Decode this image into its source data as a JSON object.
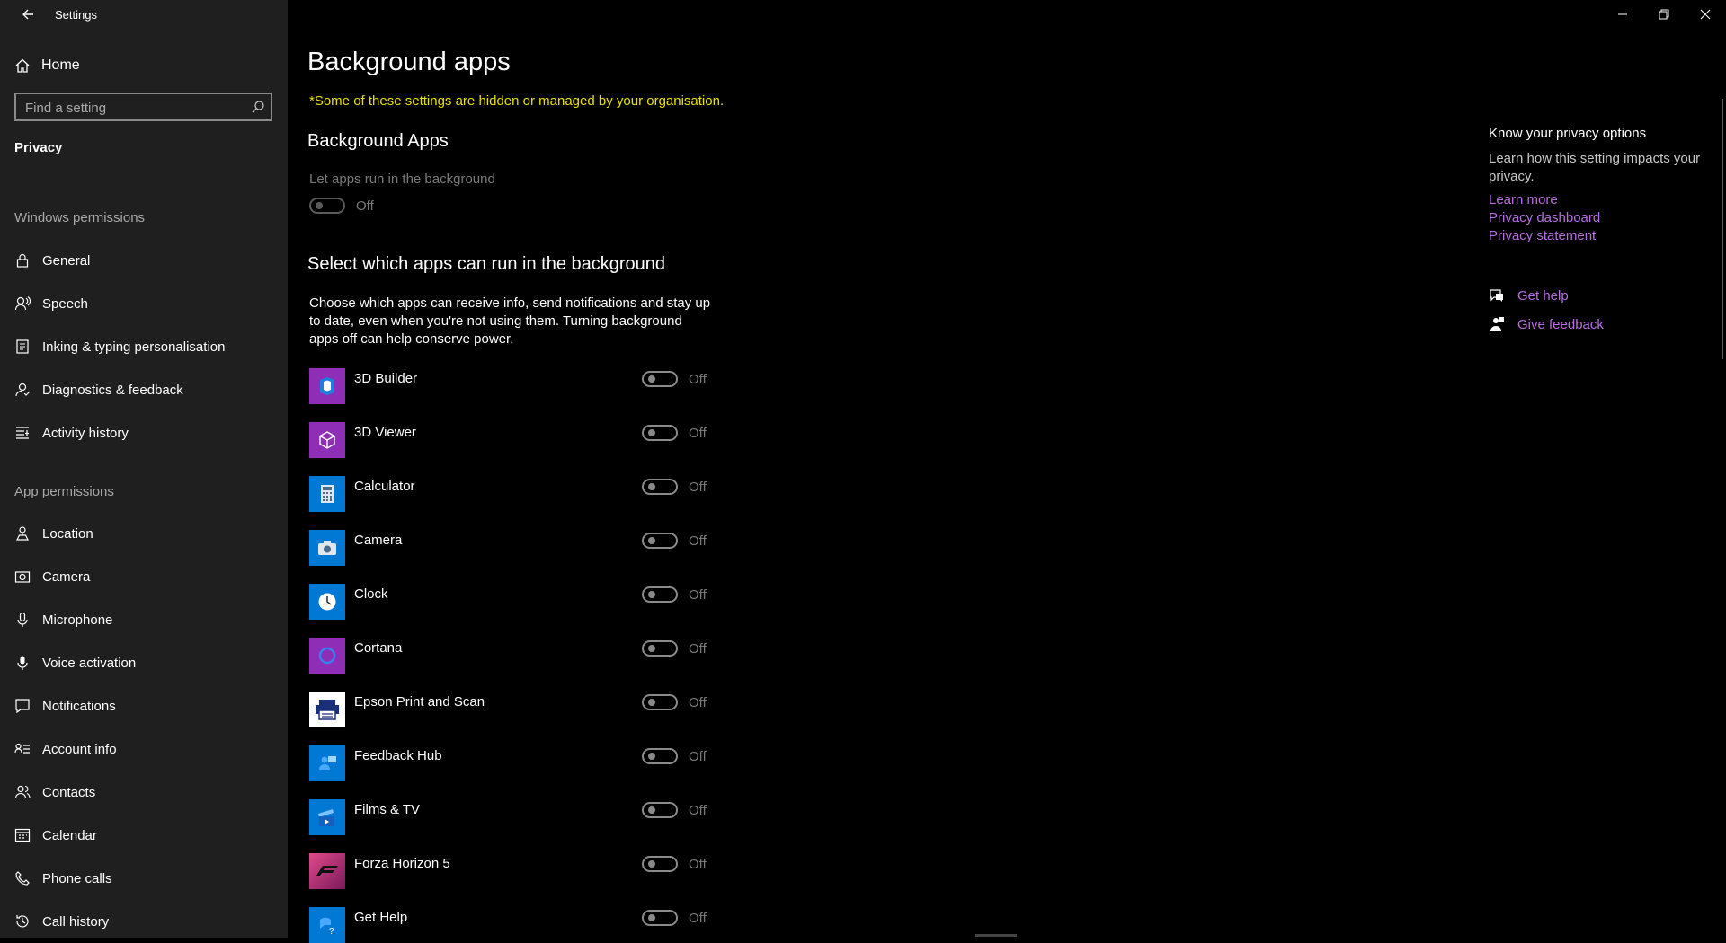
{
  "window": {
    "title": "Settings"
  },
  "sidebar": {
    "home": "Home",
    "search_placeholder": "Find a setting",
    "section": "Privacy",
    "windows_permissions_label": "Windows permissions",
    "windows_permissions": [
      {
        "label": "General",
        "icon": "lock-icon"
      },
      {
        "label": "Speech",
        "icon": "speech-icon"
      },
      {
        "label": "Inking & typing personalisation",
        "icon": "inking-icon"
      },
      {
        "label": "Diagnostics & feedback",
        "icon": "diagnostics-icon"
      },
      {
        "label": "Activity history",
        "icon": "activity-history-icon"
      }
    ],
    "app_permissions_label": "App permissions",
    "app_permissions": [
      {
        "label": "Location",
        "icon": "location-icon"
      },
      {
        "label": "Camera",
        "icon": "camera-icon"
      },
      {
        "label": "Microphone",
        "icon": "microphone-icon"
      },
      {
        "label": "Voice activation",
        "icon": "voice-activation-icon"
      },
      {
        "label": "Notifications",
        "icon": "notifications-icon"
      },
      {
        "label": "Account info",
        "icon": "account-info-icon"
      },
      {
        "label": "Contacts",
        "icon": "contacts-icon"
      },
      {
        "label": "Calendar",
        "icon": "calendar-icon"
      },
      {
        "label": "Phone calls",
        "icon": "phone-icon"
      },
      {
        "label": "Call history",
        "icon": "call-history-icon"
      }
    ]
  },
  "main": {
    "title": "Background apps",
    "org_note": "*Some of these settings are hidden or managed by your organisation.",
    "bg_heading": "Background Apps",
    "let_apps_label": "Let apps run in the background",
    "master_toggle_state": "Off",
    "select_heading": "Select which apps can run in the background",
    "description": "Choose which apps can receive info, send notifications and stay up to date, even when you're not using them. Turning background apps off can help conserve power.",
    "apps": [
      {
        "name": "3D Builder",
        "state": "Off",
        "icon": "3d-builder-icon",
        "color": "#8e2eb7"
      },
      {
        "name": "3D Viewer",
        "state": "Off",
        "icon": "3d-viewer-icon",
        "color": "#8e2eb7"
      },
      {
        "name": "Calculator",
        "state": "Off",
        "icon": "calculator-icon",
        "color": "#0078d4"
      },
      {
        "name": "Camera",
        "state": "Off",
        "icon": "camera-app-icon",
        "color": "#0078d4"
      },
      {
        "name": "Clock",
        "state": "Off",
        "icon": "clock-icon",
        "color": "#0078d4"
      },
      {
        "name": "Cortana",
        "state": "Off",
        "icon": "cortana-icon",
        "color": "#8e2eb7"
      },
      {
        "name": "Epson Print and Scan",
        "state": "Off",
        "icon": "epson-icon",
        "color": "#ffffff"
      },
      {
        "name": "Feedback Hub",
        "state": "Off",
        "icon": "feedback-hub-icon",
        "color": "#0078d4"
      },
      {
        "name": "Films & TV",
        "state": "Off",
        "icon": "films-tv-icon",
        "color": "#0078d4"
      },
      {
        "name": "Forza Horizon 5",
        "state": "Off",
        "icon": "forza-icon",
        "color": "#d0306e"
      },
      {
        "name": "Get Help",
        "state": "Off",
        "icon": "get-help-app-icon",
        "color": "#0078d4"
      }
    ]
  },
  "right_panel": {
    "title": "Know your privacy options",
    "text": "Learn how this setting impacts your privacy.",
    "links": [
      "Learn more",
      "Privacy dashboard",
      "Privacy statement"
    ],
    "get_help": "Get help",
    "give_feedback": "Give feedback"
  }
}
